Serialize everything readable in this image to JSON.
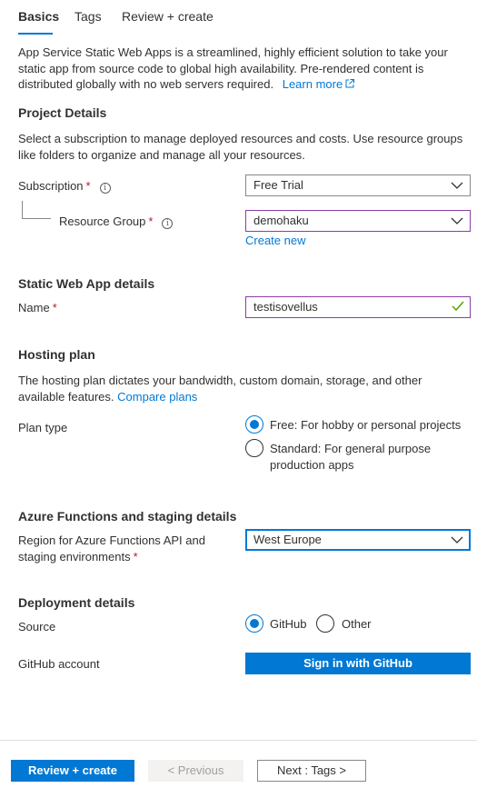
{
  "tabs": [
    {
      "label": "Basics"
    },
    {
      "label": "Tags"
    },
    {
      "label": "Review + create"
    }
  ],
  "intro": {
    "text": "App Service Static Web Apps is a streamlined, highly efficient solution to take your static app from source code to global high availability. Pre-rendered content is distributed globally with no web servers required.",
    "learn_more": "Learn more"
  },
  "project_details": {
    "title": "Project Details",
    "description": "Select a subscription to manage deployed resources and costs. Use resource groups like folders to organize and manage all your resources.",
    "subscription_label": "Subscription",
    "subscription_value": "Free Trial",
    "resource_group_label": "Resource Group",
    "resource_group_value": "demohaku",
    "create_new": "Create new"
  },
  "app_details": {
    "title": "Static Web App details",
    "name_label": "Name",
    "name_value": "testisovellus"
  },
  "hosting": {
    "title": "Hosting plan",
    "description": "The hosting plan dictates your bandwidth, custom domain, storage, and other available features.",
    "compare_plans": "Compare plans",
    "plan_type_label": "Plan type",
    "options": [
      {
        "label": "Free: For hobby or personal projects",
        "selected": true
      },
      {
        "label": "Standard: For general purpose production apps",
        "selected": false
      }
    ]
  },
  "functions": {
    "title": "Azure Functions and staging details",
    "region_label": "Region for Azure Functions API and staging environments",
    "region_value": "West Europe"
  },
  "deployment": {
    "title": "Deployment details",
    "source_label": "Source",
    "source_options": [
      {
        "label": "GitHub",
        "selected": true
      },
      {
        "label": "Other",
        "selected": false
      }
    ],
    "github_account_label": "GitHub account",
    "sign_in_button": "Sign in with GitHub"
  },
  "footer": {
    "review_create": "Review + create",
    "previous": "< Previous",
    "next": "Next : Tags >"
  },
  "colors": {
    "accent": "#0078d4",
    "required": "#a4262c",
    "valid_border": "#8a3ea6",
    "valid_check": "#57a300"
  }
}
